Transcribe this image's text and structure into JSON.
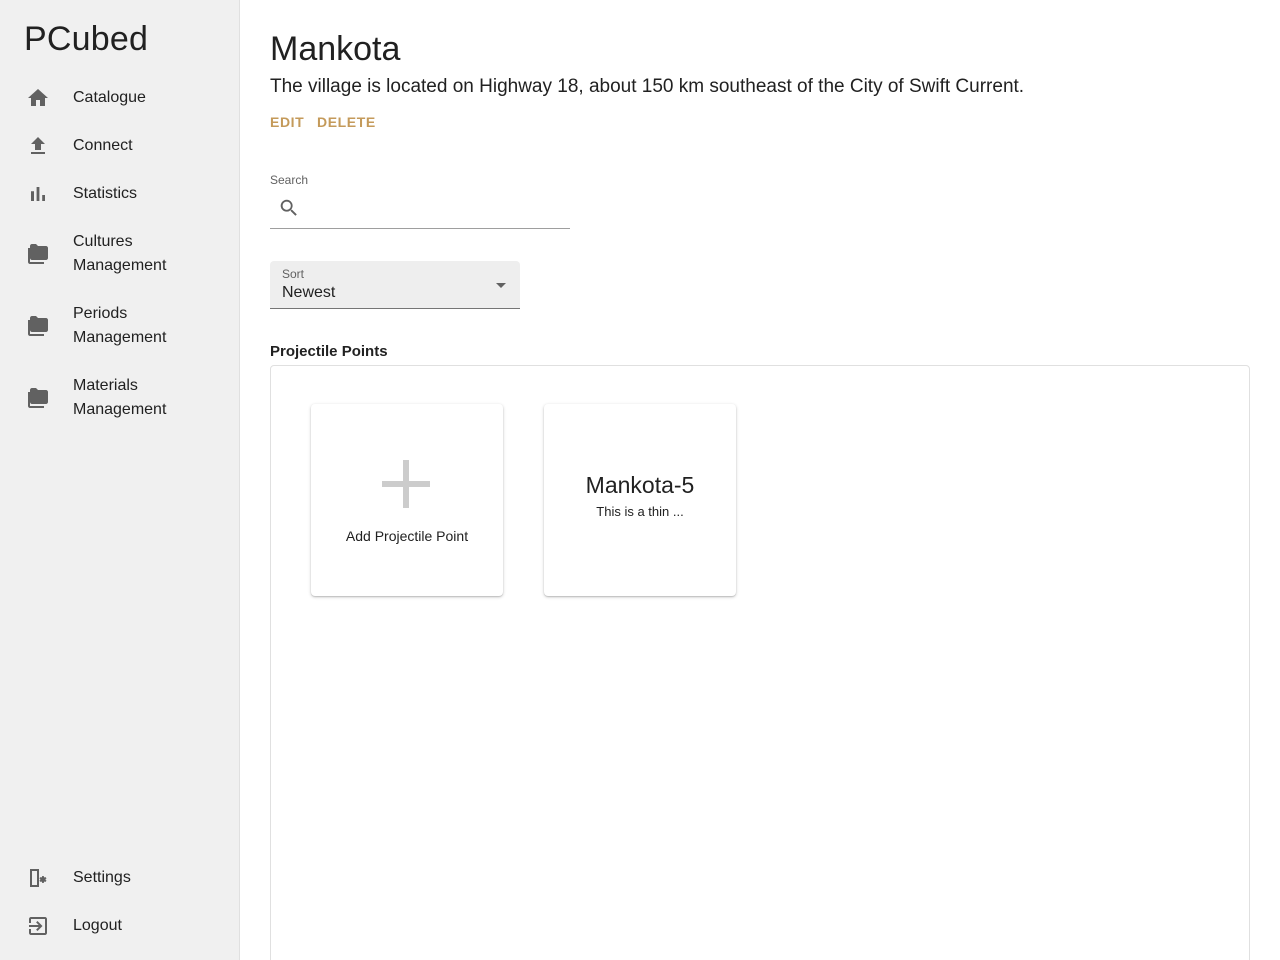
{
  "sidebar": {
    "brand": "PCubed",
    "items": [
      {
        "label": "Catalogue",
        "icon": "home-icon"
      },
      {
        "label": "Connect",
        "icon": "upload-icon"
      },
      {
        "label": "Statistics",
        "icon": "bar-chart-icon"
      },
      {
        "label": "Cultures Management",
        "icon": "folder-icon"
      },
      {
        "label": "Periods Management",
        "icon": "folder-icon"
      },
      {
        "label": "Materials Management",
        "icon": "folder-icon"
      }
    ],
    "bottom_items": [
      {
        "label": "Settings",
        "icon": "settings-icon"
      },
      {
        "label": "Logout",
        "icon": "logout-icon"
      }
    ]
  },
  "page": {
    "title": "Mankota",
    "description": "The village is located on Highway 18, about 150 km southeast of the City of Swift Current.",
    "edit_label": "EDIT",
    "delete_label": "DELETE"
  },
  "search": {
    "label": "Search",
    "value": ""
  },
  "sort": {
    "label": "Sort",
    "value": "Newest"
  },
  "projectile_points": {
    "section_title": "Projectile Points",
    "add_label": "Add Projectile Point",
    "items": [
      {
        "name": "Mankota-5",
        "description": "This is a thin ..."
      }
    ]
  },
  "colors": {
    "accent": "#c49a5a",
    "sidebar_bg": "#f0f0f0",
    "icon": "#616161"
  }
}
